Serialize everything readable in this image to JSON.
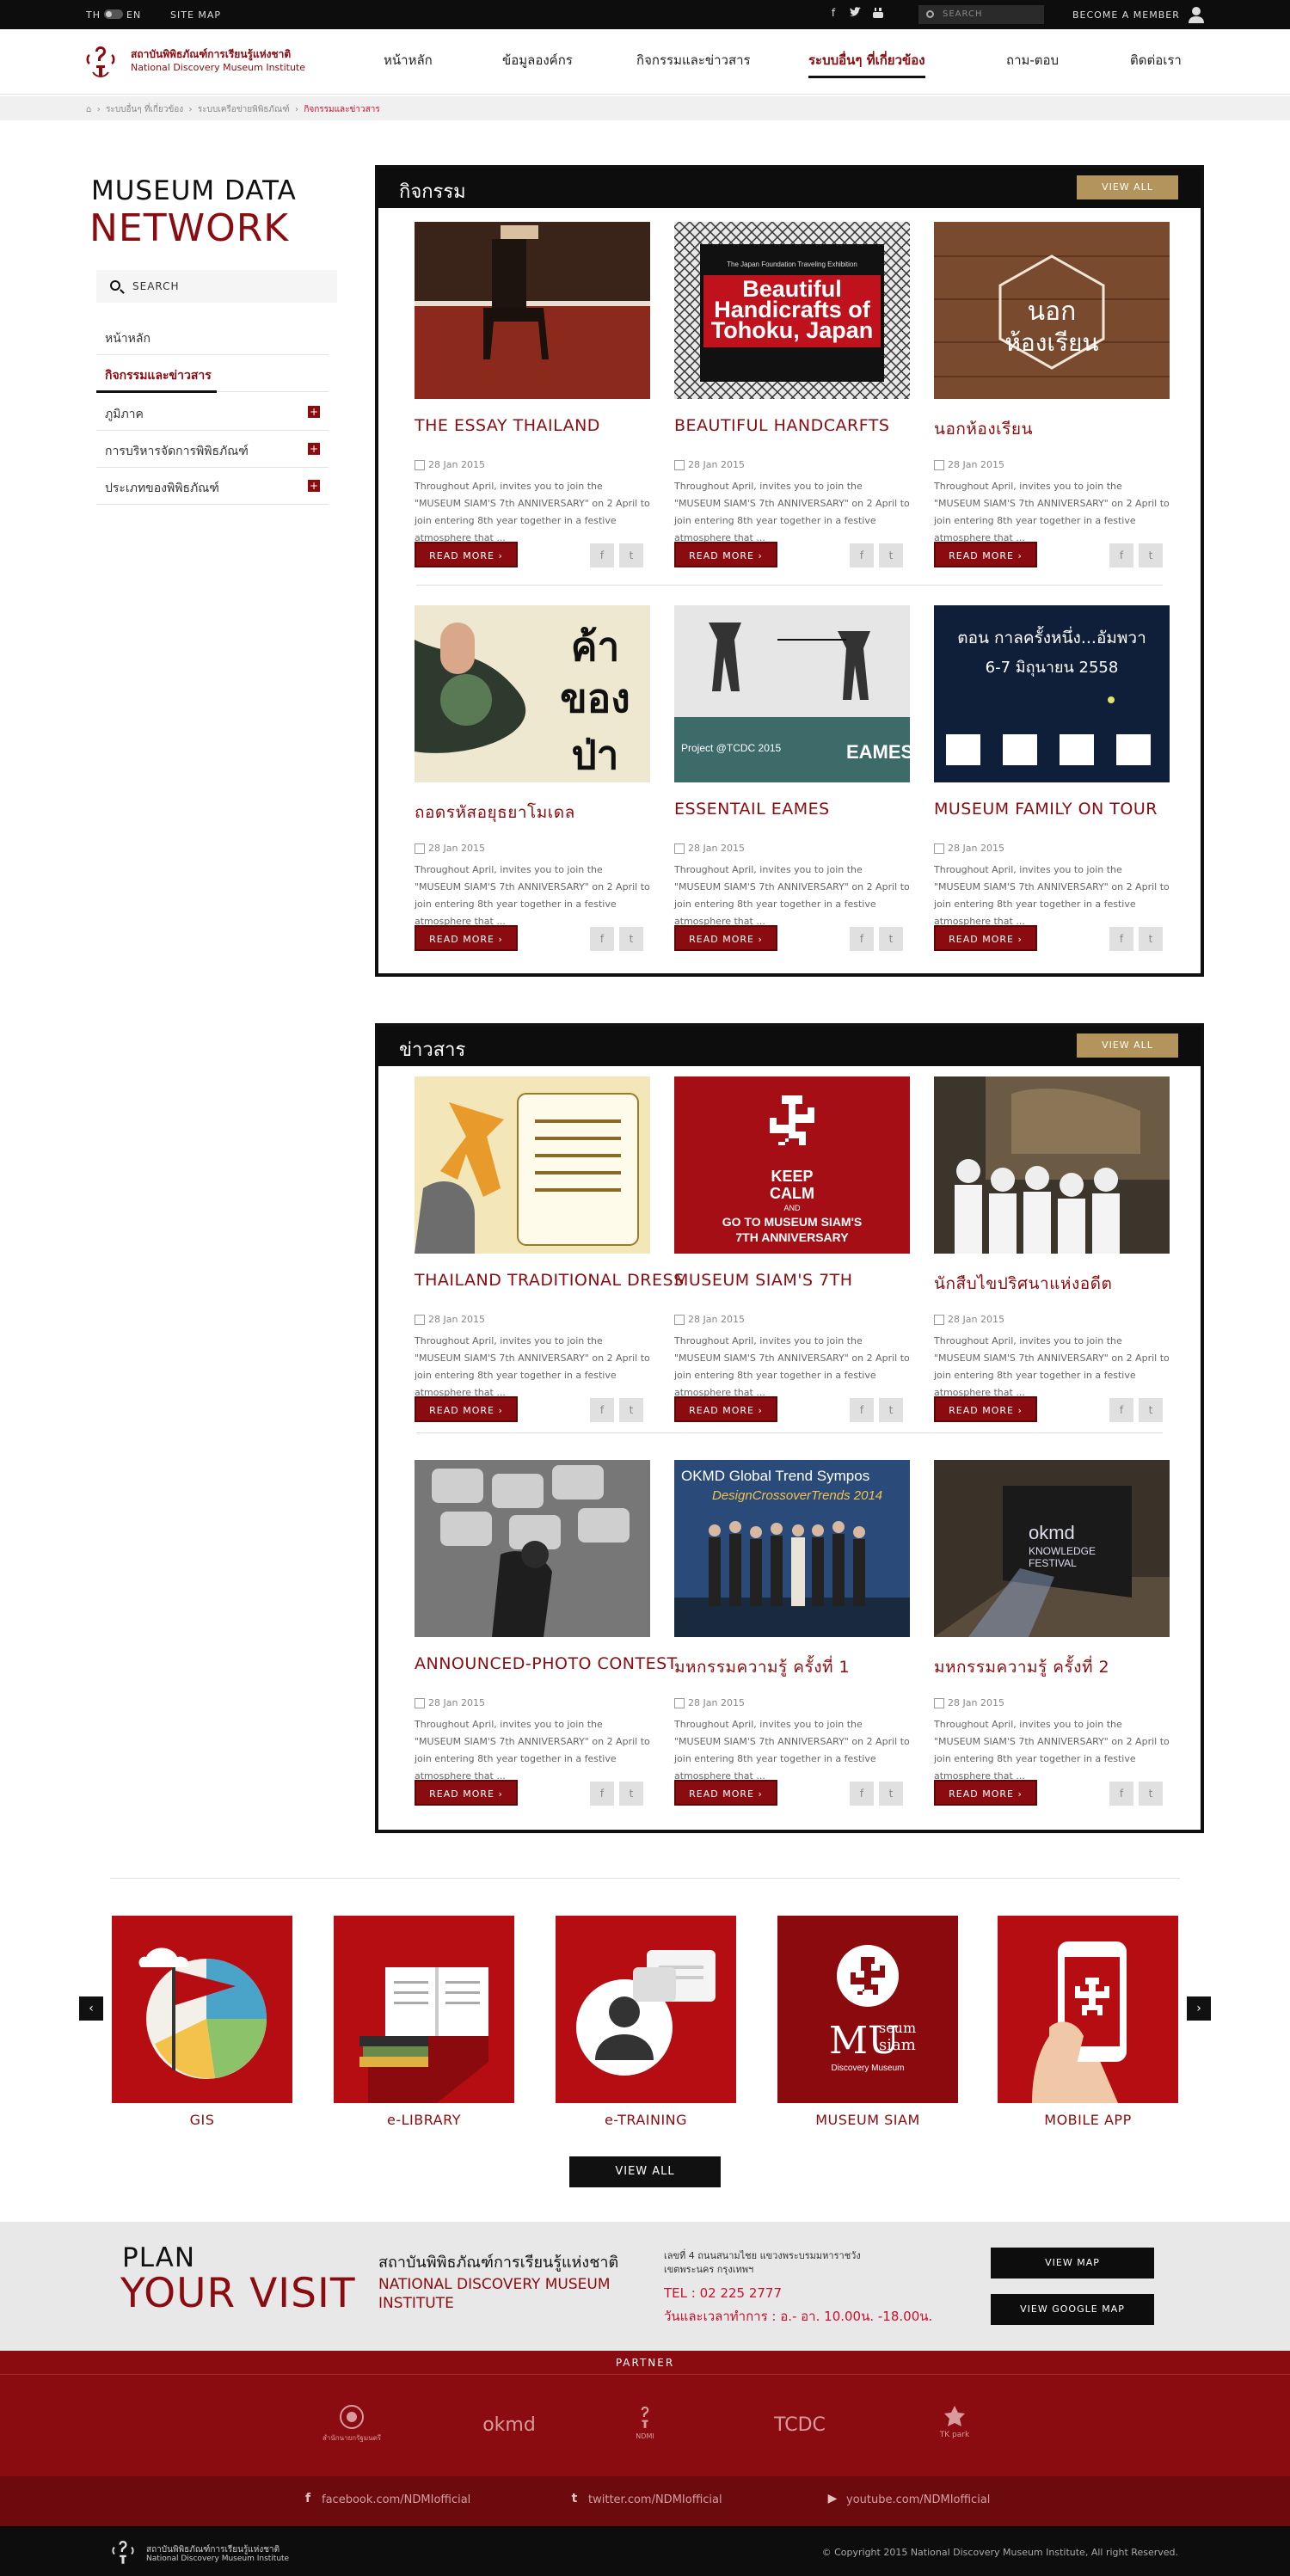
{
  "topbar": {
    "lang_th": "TH",
    "lang_en": "EN",
    "sitemap": "SITE MAP",
    "search_placeholder": "SEARCH",
    "member": "BECOME A MEMBER"
  },
  "header": {
    "logo_th": "สถาบันพิพิธภัณฑ์การเรียนรู้แห่งชาติ",
    "logo_en": "National Discovery Museum Institute",
    "nav": [
      "หน้าหลัก",
      "ข้อมูลองค์กร",
      "กิจกรรมและข่าวสาร",
      "ระบบอื่นๆ ที่เกี่ยวข้อง",
      "ถาม-ตอบ",
      "ติดต่อเรา"
    ]
  },
  "breadcrumb": {
    "a": "ระบบอื่นๆ ที่เกี่ยวข้อง",
    "b": "ระบบเครือข่ายพิพิธภัณฑ์",
    "current": "กิจกรรมและข่าวสาร"
  },
  "sidebar": {
    "title1": "MUSEUM DATA",
    "title2": "NETWORK",
    "search": "SEARCH",
    "items": [
      "หน้าหลัก",
      "กิจกรรมและข่าวสาร",
      "ภูมิภาค",
      "การบริหารจัดการพิพิธภัณฑ์",
      "ประเภทของพิพิธภัณฑ์"
    ]
  },
  "common": {
    "date": "28 Jan 2015",
    "desc": "Throughout April, invites you to join the \"MUSEUM SIAM'S 7th ANNIVERSARY\" on 2 April to join entering 8th year together in a festive atmosphere that ...",
    "read_more": "READ MORE ›",
    "view_all": "VIEW ALL"
  },
  "activities": {
    "title": "กิจกรรม",
    "cards": [
      "THE ESSAY THAILAND",
      "BEAUTIFUL HANDCARFTS",
      "นอกห้องเรียน",
      "ถอดรหัสอยุธยาโมเดล",
      "ESSENTAIL EAMES",
      "MUSEUM FAMILY ON TOUR"
    ]
  },
  "news": {
    "title": "ข่าวสาร",
    "cards": [
      "THAILAND TRADITIONAL DRESS",
      "MUSEUM SIAM'S 7TH",
      "นักสืบไขปริศนาแห่งอดีต",
      "ANNOUNCED-PHOTO CONTEST",
      "มหกรรมความรู้ ครั้งที่ 1",
      "มหกรรมความรู้ ครั้งที่ 2"
    ]
  },
  "image_text": {
    "handicraft_top": "The Japan Foundation Traveling Exhibition",
    "handicraft_main": "Beautiful Handicrafts of Tohoku, Japan",
    "nok1": "นอก",
    "nok2": "ห้องเรียน",
    "kha1": "ค้า",
    "kha2": "ของ",
    "kha3": "ป่า",
    "tcdc": "Project @TCDC 2015",
    "eames": "EAMES",
    "family1": "ตอน กาลครั้งหนึ่ง...อัมพวา",
    "family2": "6-7 มิถุนายน 2558",
    "keep1": "KEEP",
    "keep2": "CALM",
    "keep3": "AND",
    "keep4": "GO TO MUSEUM SIAM'S",
    "keep5": "7TH ANNIVERSARY",
    "okmd_top": "OKMD Global Trend Sympos",
    "okmd_sub": "DesignCrossoverTrends 2014",
    "kf1": "okmd",
    "kf2": "KNOWLEDGE",
    "kf3": "FESTIVAL",
    "ms1": "MU",
    "ms2": "seum",
    "ms3": "siam",
    "ms4": "Discovery Museum"
  },
  "services": {
    "items": [
      "GIS",
      "e-LIBRARY",
      "e-TRAINING",
      "MUSEUM SIAM",
      "MOBILE APP"
    ],
    "view_all": "VIEW ALL"
  },
  "plan": {
    "p1": "PLAN",
    "p2": "YOUR VISIT",
    "org_th": "สถาบันพิพิธภัณฑ์การเรียนรู้แห่งชาติ",
    "org_en": "NATIONAL DISCOVERY MUSEUM INSTITUTE",
    "addr": "เลขที่ 4 ถนนสนามไชย แขวงพระบรมมหาราชวัง เขตพระนคร กรุงเทพฯ",
    "tel": "TEL : 02 225 2777",
    "hours": "วันและเวลาทำการ : อ.- อา. 10.00น. -18.00น.",
    "btn_map": "VIEW MAP",
    "btn_gmap": "VIEW GOOGLE MAP"
  },
  "partner": {
    "title": "PARTNER",
    "logos": [
      "สำนักนายกรัฐมนตรี",
      "okmd",
      "NDMI",
      "TCDC",
      "TK park"
    ]
  },
  "social": {
    "facebook": "facebook.com/NDMIofficial",
    "twitter": "twitter.com/NDMIofficial",
    "youtube": "youtube.com/NDMIofficial"
  },
  "footer": {
    "logo_th": "สถาบันพิพิธภัณฑ์การเรียนรู้แห่งชาติ",
    "logo_en": "National Discovery Museum Institute",
    "copyright": "© Copyright 2015 National Discovery Museum Institute, All right Reserved."
  },
  "colors": {
    "brand": "#8a0c10",
    "accent": "#b3945c",
    "dark": "#0d0d0d"
  }
}
